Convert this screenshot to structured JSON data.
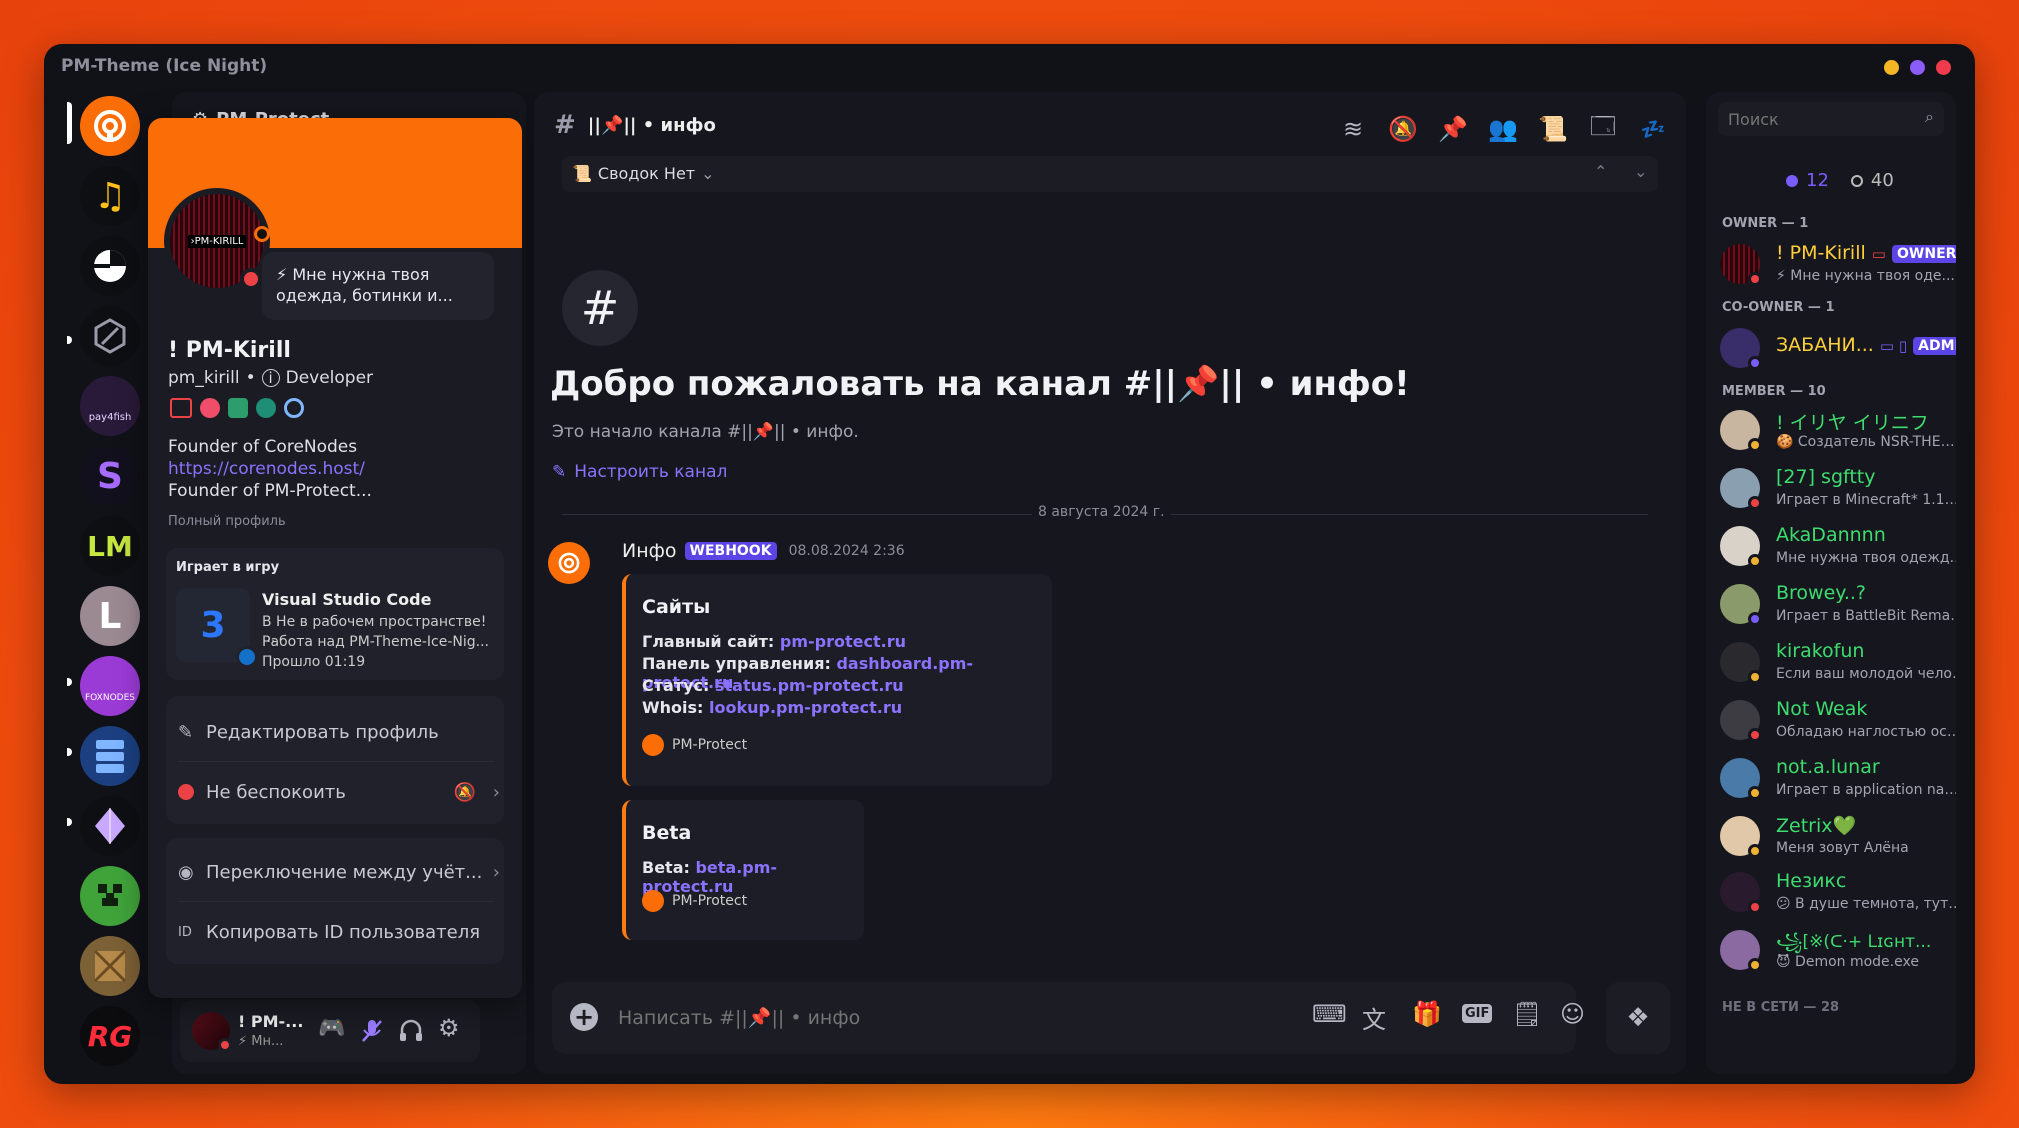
{
  "window": {
    "title": "PM-Theme (Ice Night)"
  },
  "colors": {
    "accent": "#fb6d07",
    "purple": "#5b45e6",
    "link": "#8b72ff",
    "dnd": "#ed4245",
    "idle": "#f0b232",
    "online": "#7b5cff"
  },
  "servers": [
    {
      "name": "pm-protect",
      "icon": "orange-radar-icon"
    },
    {
      "name": "music",
      "icon": "music-note-icon"
    },
    {
      "name": "server-3",
      "icon": "pie-icon"
    },
    {
      "name": "server-4",
      "icon": "cube-outline-icon"
    },
    {
      "name": "pay4fish",
      "label": "pay4fish"
    },
    {
      "name": "server-6",
      "label": "S"
    },
    {
      "name": "server-7",
      "label": "LM"
    },
    {
      "name": "server-8",
      "label": "L"
    },
    {
      "name": "foxnodes",
      "label": "FOXNODES"
    },
    {
      "name": "server-10",
      "icon": "server-rack-icon"
    },
    {
      "name": "server-11",
      "icon": "crystal-icon"
    },
    {
      "name": "minecraft",
      "icon": "creeper-icon"
    },
    {
      "name": "server-13",
      "icon": "crate-icon"
    },
    {
      "name": "server-14",
      "label": "RG"
    }
  ],
  "server_header": {
    "name": "PM-Protect"
  },
  "profile": {
    "custom_status": "⚡ Мне нужна твоя одежда, ботинки и...",
    "display_name": "! PM-Kirill",
    "username": "pm_kirill",
    "pronoun_sep": "•",
    "role_text": "Developer",
    "bio_line1": "Founder of CoreNodes",
    "bio_link": "https://corenodes.host/",
    "bio_line3": "Founder of PM-Protect...",
    "full_profile": "Полный профиль",
    "activity_header": "Играет в игру",
    "activity_name": "Visual Studio Code",
    "activity_details": "В Не в рабочем пространстве! ...",
    "activity_state": "Работа над PM-Theme-Ice-Nig...",
    "activity_elapsed": "Прошло 01:19",
    "menu_edit": "Редактировать профиль",
    "menu_status": "Не беспокоить",
    "menu_switch": "Переключение между учёт...",
    "menu_copy_id": "Копировать ID пользователя"
  },
  "user_panel": {
    "name": "! PM-...",
    "status": "⚡ Мн..."
  },
  "channel": {
    "name": "||📌|| • инфо",
    "summaries": "Сводок Нет",
    "welcome_title": "Добро пожаловать на канал #||📌|| • инфо!",
    "welcome_sub": "Это начало канала #||📌|| • инфо.",
    "configure": "Настроить канал",
    "date_divider": "8 августа 2024 г.",
    "input_placeholder": "Написать #||📌|| • инфо"
  },
  "message": {
    "author": "Инфо",
    "tag": "WEBHOOK",
    "timestamp": "08.08.2024 2:36",
    "embed1": {
      "title": "Сайты",
      "rows": [
        {
          "label": "Главный сайт:",
          "value": "pm-protect.ru"
        },
        {
          "label": "Панель управления:",
          "value": "dashboard.pm-protect.ru"
        },
        {
          "label": "Статус:",
          "value": "status.pm-protect.ru"
        },
        {
          "label": "Whois:",
          "value": "lookup.pm-protect.ru"
        }
      ],
      "footer": "PM-Protect"
    },
    "embed2": {
      "title": "Beta",
      "row_label": "Beta:",
      "row_value": "beta.pm-protect.ru",
      "footer": "PM-Protect"
    }
  },
  "search": {
    "placeholder": "Поиск"
  },
  "counts": {
    "online": "12",
    "offline": "40"
  },
  "groups": {
    "owner": "OWNER — 1",
    "coowner": "CO-OWNER — 1",
    "member": "MEMBER — 10",
    "offline": "НЕ В СЕТИ — 28"
  },
  "members": [
    {
      "name": "! PM-Kirill",
      "badge": "OWNER",
      "status": "⚡ Мне нужна твоя оде...",
      "color": "#ffcf3a"
    },
    {
      "name": "ЗАБАНИ...",
      "badge": "ADMIN",
      "status": "",
      "color": "#ffcf3a"
    },
    {
      "name": "! イリヤ イリニフ",
      "status": "🍪 Создатель NSR-THEME,...",
      "color": "#3ddc6e"
    },
    {
      "name": "[27] sgftty",
      "status": "Играет в Minecraft* 1.16.5",
      "color": "#3ddc6e"
    },
    {
      "name": "AkaDannnn",
      "status": "Мне нужна твоя одежда,...",
      "color": "#3ddc6e"
    },
    {
      "name": "Browey..?",
      "status": "Играет в BattleBit Remas...",
      "color": "#3ddc6e"
    },
    {
      "name": "kirakofun",
      "status": "Если ваш молодой человек ...",
      "color": "#3ddc6e"
    },
    {
      "name": "Not Weak",
      "status": "Обладаю наглостью остава...",
      "color": "#3ddc6e"
    },
    {
      "name": "not.a.lunar",
      "status": "Играет в application name",
      "color": "#3ddc6e"
    },
    {
      "name": "Zetrix💚",
      "status": "Меня зовут Алёна",
      "color": "#3ddc6e"
    },
    {
      "name": "Незикс",
      "status": "😕 В душе темнота, тут нет...",
      "color": "#3ddc6e"
    },
    {
      "name": "꧁[※(ᑕ·+ Lɪɢʜᴛ...",
      "status": "😈 Demon mode.exe",
      "color": "#3ddc6e"
    }
  ]
}
